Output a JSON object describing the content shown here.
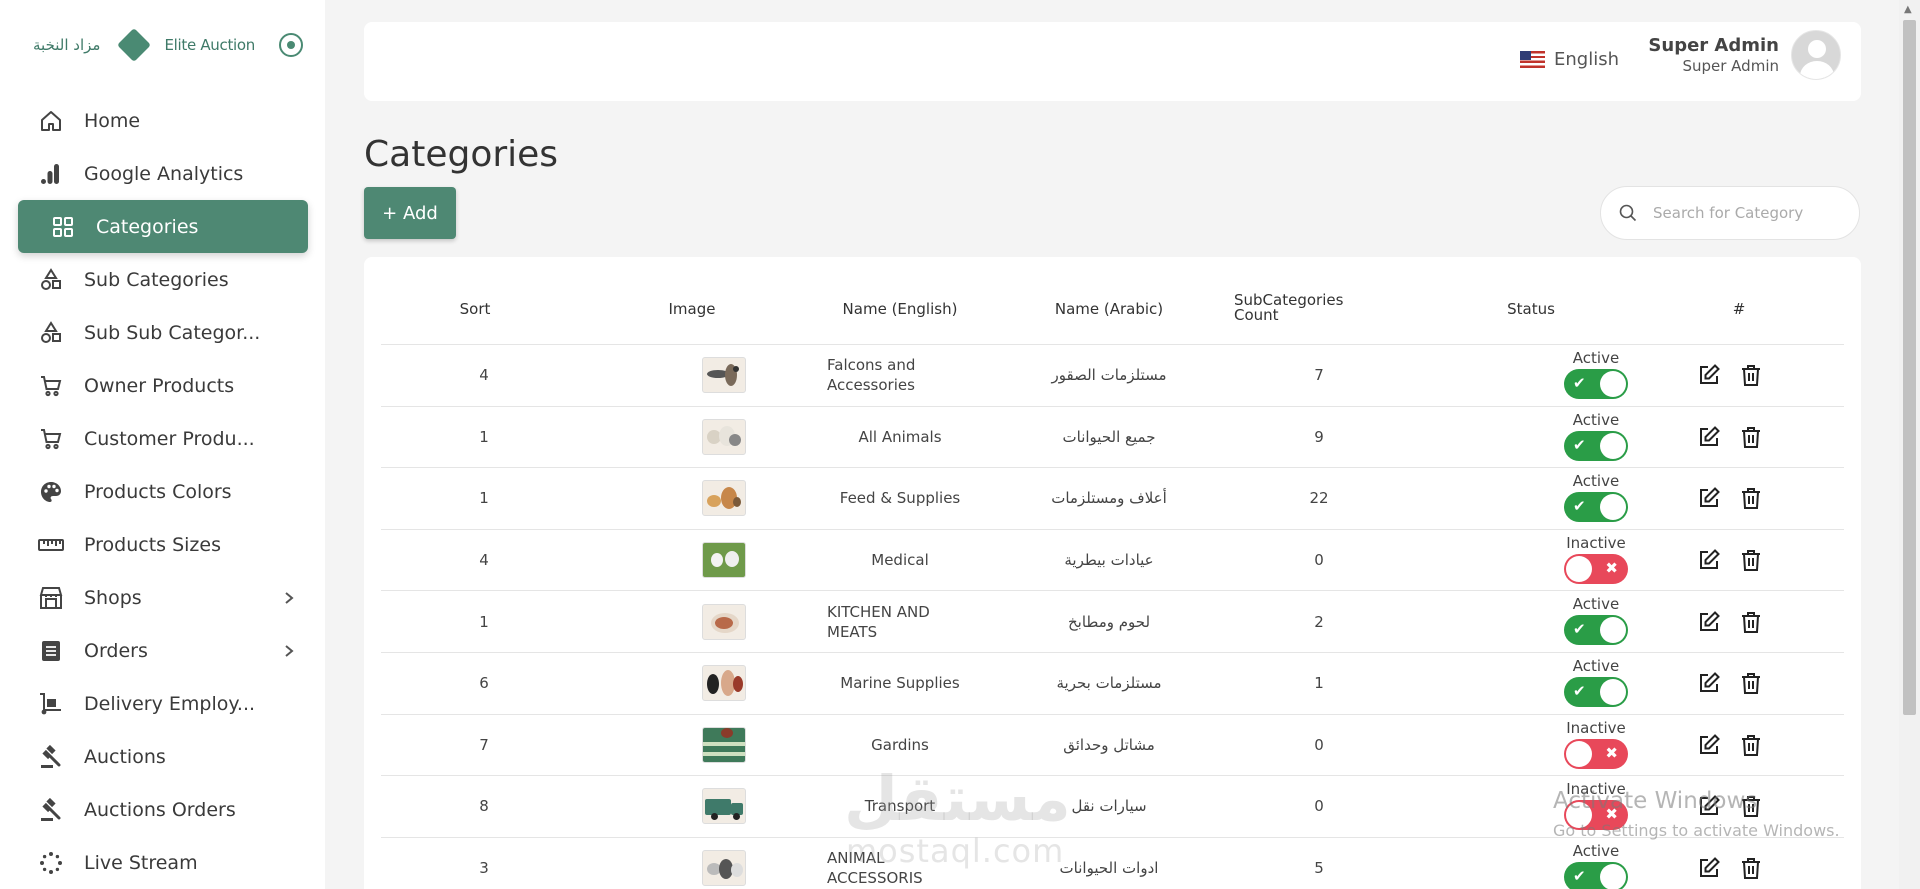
{
  "brand": {
    "arabic": "مزاد النخبة",
    "english": "Elite Auction"
  },
  "sidebar": {
    "items": [
      {
        "label": "Home",
        "icon": "home-icon"
      },
      {
        "label": "Google Analytics",
        "icon": "analytics-icon"
      },
      {
        "label": "Categories",
        "icon": "grid-icon",
        "active": true
      },
      {
        "label": "Sub Categories",
        "icon": "shapes-icon"
      },
      {
        "label": "Sub Sub Categor...",
        "icon": "shapes-icon"
      },
      {
        "label": "Owner Products",
        "icon": "cart-icon"
      },
      {
        "label": "Customer Produ...",
        "icon": "cart-icon"
      },
      {
        "label": "Products Colors",
        "icon": "palette-icon"
      },
      {
        "label": "Products Sizes",
        "icon": "ruler-icon"
      },
      {
        "label": "Shops",
        "icon": "shop-icon",
        "expandable": true
      },
      {
        "label": "Orders",
        "icon": "list-icon",
        "expandable": true
      },
      {
        "label": "Delivery Employ...",
        "icon": "dolly-icon"
      },
      {
        "label": "Auctions",
        "icon": "gavel-icon"
      },
      {
        "label": "Auctions Orders",
        "icon": "gavel-icon"
      },
      {
        "label": "Live Stream",
        "icon": "spinner-icon"
      }
    ]
  },
  "header": {
    "language": "English",
    "user_name": "Super Admin",
    "user_role": "Super Admin"
  },
  "page": {
    "title": "Categories",
    "add_label": "+ Add",
    "search_placeholder": "Search for Category"
  },
  "table": {
    "columns": {
      "sort": "Sort",
      "image": "Image",
      "name_en": "Name (English)",
      "name_ar": "Name (Arabic)",
      "count_line1": "SubCategories",
      "count_line2": "Count",
      "status": "Status",
      "actions": "#"
    },
    "rows": [
      {
        "sort": "4",
        "name_en": "Falcons and Accessories",
        "name_ar": "مستلزمات الصقور",
        "count": "7",
        "status": "Active",
        "active": true,
        "thumb": "falcon"
      },
      {
        "sort": "1",
        "name_en": "All Animals",
        "name_ar": "جميع الحيوانات",
        "count": "9",
        "status": "Active",
        "active": true,
        "thumb": "animals"
      },
      {
        "sort": "1",
        "name_en": "Feed & Supplies",
        "name_ar": "أعلاف ومستلزمات",
        "count": "22",
        "status": "Active",
        "active": true,
        "thumb": "feed"
      },
      {
        "sort": "4",
        "name_en": "Medical",
        "name_ar": "عيادات بيطرية",
        "count": "0",
        "status": "Inactive",
        "active": false,
        "thumb": "medical"
      },
      {
        "sort": "1",
        "name_en": "KITCHEN AND MEATS",
        "name_ar": "لحوم ومطابخ",
        "count": "2",
        "status": "Active",
        "active": true,
        "thumb": "meat"
      },
      {
        "sort": "6",
        "name_en": "Marine Supplies",
        "name_ar": "مستلزمات بحرية",
        "count": "1",
        "status": "Active",
        "active": true,
        "thumb": "marine"
      },
      {
        "sort": "7",
        "name_en": "Gardins",
        "name_ar": "مشاتل وحدائق",
        "count": "0",
        "status": "Inactive",
        "active": false,
        "thumb": "garden"
      },
      {
        "sort": "8",
        "name_en": "Transport",
        "name_ar": "سيارات نقل",
        "count": "0",
        "status": "Inactive",
        "active": false,
        "thumb": "truck"
      },
      {
        "sort": "3",
        "name_en": "ANIMAL ACCESSORIS",
        "name_ar": "ادوات الحيوانات",
        "count": "5",
        "status": "Active",
        "active": true,
        "thumb": "accessories"
      }
    ]
  },
  "overlays": {
    "watermark": "مستقل",
    "watermark_sub": "mostaql.com",
    "activate_title": "Activate Windows",
    "activate_sub": "Go to Settings to activate Windows."
  },
  "colors": {
    "accent": "#4e8873",
    "active": "#2a9d47",
    "inactive": "#e8485a"
  }
}
